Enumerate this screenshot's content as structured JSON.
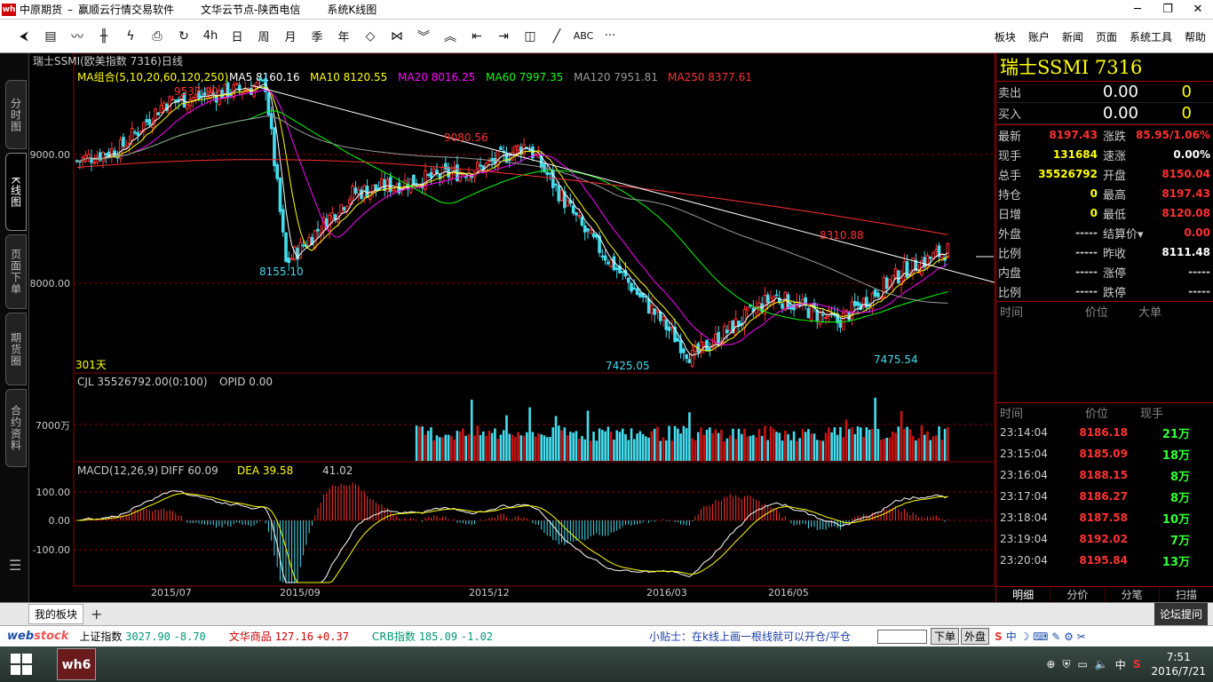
{
  "window": {
    "logo": "wh",
    "title": "中原期货",
    "dash": "–",
    "software": "赢顺云行情交易软件",
    "node": "文华云节点-陕西电信",
    "linetype": "系统K线图",
    "min": "─",
    "restore": "❐",
    "close": "✕"
  },
  "toolbar": {
    "icons": [
      "back-icon",
      "quote-list-icon",
      "line-chart-icon",
      "kline-icon",
      "flash-icon",
      "save-icon",
      "refresh-icon"
    ],
    "periods": [
      "4h",
      "日",
      "周",
      "月",
      "季",
      "年"
    ],
    "tools_icons": [
      "diamond-icon",
      "bowtie-icon",
      "chevron-down-double-icon",
      "chevron-up-double-icon",
      "arrow-left-icon",
      "arrow-right-icon",
      "grid-icon",
      "draw-line-icon"
    ],
    "abc": "ABC",
    "more": "···",
    "menus": [
      "板块",
      "账户",
      "新闻",
      "页面",
      "系统工具",
      "帮助"
    ]
  },
  "left_tabs": [
    "分时图",
    "K线图",
    "页面下单",
    "期货圈",
    "合约资料"
  ],
  "left_menu_icon": "☰",
  "chart": {
    "header": "瑞士SSMI(欧美指数 7316)日线",
    "ma_label": "MA组合(5,10,20,60,120,250)",
    "ma": [
      {
        "name": "MA5 8160.16",
        "color": "#ffffff"
      },
      {
        "name": "MA10 8120.55",
        "color": "#ffff00"
      },
      {
        "name": "MA20 8016.25",
        "color": "#ff00ff"
      },
      {
        "name": "MA60 7997.35",
        "color": "#00ff00"
      },
      {
        "name": "MA120 7951.81",
        "color": "#9a9a9a"
      },
      {
        "name": "MA250 8377.61",
        "color": "#ff3030"
      }
    ],
    "price_axis": [
      "9000.00",
      "8000.00"
    ],
    "annotations": [
      "9537.90",
      "8155.10",
      "9080.56",
      "7425.05",
      "8310.88",
      "7475.54"
    ],
    "days": "301天",
    "volume_label": "CJL 35526792.00(0:100)",
    "opid_label": "OPID 0.00",
    "volume_axis": "7000万",
    "macd_label": "MACD(12,26,9)",
    "diff_label": "DIFF 60.09",
    "dea_label": "DEA 39.58",
    "macd_value": "41.02",
    "macd_axis": [
      "100.00",
      "0.00",
      "-100.00"
    ],
    "date_axis": [
      "2015/07",
      "2015/09",
      "2015/12",
      "2016/03",
      "2016/05"
    ]
  },
  "quote": {
    "title": "瑞士SSMI  7316",
    "sell_label": "卖出",
    "sell_price": "0.00",
    "sell_vol": "0",
    "buy_label": "买入",
    "buy_price": "0.00",
    "buy_vol": "0",
    "fields": [
      {
        "k": "最新",
        "v": "8197.43",
        "c": "#ff3030"
      },
      {
        "k": "涨跌",
        "v": "85.95/1.06%",
        "c": "#ff3030"
      },
      {
        "k": "现手",
        "v": "131684",
        "c": "#ffff00"
      },
      {
        "k": "速涨",
        "v": "0.00%",
        "c": "#ffffff"
      },
      {
        "k": "总手",
        "v": "35526792",
        "c": "#ffff00"
      },
      {
        "k": "开盘",
        "v": "8150.04",
        "c": "#ff3030"
      },
      {
        "k": "持仓",
        "v": "0",
        "c": "#ffff00"
      },
      {
        "k": "最高",
        "v": "8197.43",
        "c": "#ff3030"
      },
      {
        "k": "日增",
        "v": "0",
        "c": "#ffff00"
      },
      {
        "k": "最低",
        "v": "8120.08",
        "c": "#ff3030"
      },
      {
        "k": "外盘",
        "v": "-----",
        "c": "#cccccc"
      },
      {
        "k": "结算价▾",
        "v": "0.00",
        "c": "#ff3030"
      },
      {
        "k": "比例",
        "v": "-----",
        "c": "#cccccc"
      },
      {
        "k": "昨收",
        "v": "8111.48",
        "c": "#ffffff"
      },
      {
        "k": "内盘",
        "v": "-----",
        "c": "#cccccc"
      },
      {
        "k": "涨停",
        "v": "-----",
        "c": "#cccccc"
      },
      {
        "k": "比例",
        "v": "-----",
        "c": "#cccccc"
      },
      {
        "k": "跌停",
        "v": "-----",
        "c": "#cccccc"
      }
    ],
    "bigorder_header": [
      "时间",
      "价位",
      "大单"
    ],
    "tick_header": [
      "时间",
      "价位",
      "现手"
    ],
    "ticks": [
      {
        "t": "23:14:04",
        "p": "8186.18",
        "v": "21万"
      },
      {
        "t": "23:15:04",
        "p": "8185.09",
        "v": "18万"
      },
      {
        "t": "23:16:04",
        "p": "8188.15",
        "v": "8万"
      },
      {
        "t": "23:17:04",
        "p": "8186.27",
        "v": "8万"
      },
      {
        "t": "23:18:04",
        "p": "8187.58",
        "v": "10万"
      },
      {
        "t": "23:19:04",
        "p": "8192.02",
        "v": "7万"
      },
      {
        "t": "23:20:04",
        "p": "8195.84",
        "v": "13万"
      }
    ],
    "bottom_tabs": [
      "明细",
      "分价",
      "分笔",
      "扫描"
    ]
  },
  "boardbar": {
    "tab": "我的板块",
    "plus": "+",
    "forum": "论坛提问"
  },
  "status": {
    "brand_a": "web",
    "brand_b": "stock",
    "indices": [
      {
        "n": "上证指数",
        "v": "3027.90",
        "d": "-8.70",
        "c": "g"
      },
      {
        "n": "文华商品",
        "v": "127.16",
        "d": "+0.37",
        "c": "r"
      },
      {
        "n": "CRB指数",
        "v": "185.09",
        "d": "-1.02",
        "c": "g"
      }
    ],
    "tip": "小贴士：在k线上画一根线就可以开仓/平仓",
    "btn_buy": "下单",
    "btn_plate": "外盘"
  },
  "taskbar": {
    "app": "wh6",
    "ime": "中",
    "time": "7:51",
    "date": "2016/7/21"
  },
  "chart_data": {
    "type": "candlestick",
    "title": "瑞士SSMI(欧美指数 7316)日线",
    "x_range": [
      "2015/06",
      "2016/07/21"
    ],
    "y_range": [
      7300,
      9700
    ],
    "key_points": [
      {
        "date": "2015/06",
        "value": 8950
      },
      {
        "date": "2015/07",
        "value": 9400
      },
      {
        "date": "2015/08",
        "value": 9537.9
      },
      {
        "date": "2015/08",
        "value": 8155.1
      },
      {
        "date": "2015/09",
        "value": 8700
      },
      {
        "date": "2015/11",
        "value": 8900
      },
      {
        "date": "2015/12",
        "value": 9080.56
      },
      {
        "date": "2016/01",
        "value": 8400
      },
      {
        "date": "2016/02",
        "value": 7425.05
      },
      {
        "date": "2016/03",
        "value": 7900
      },
      {
        "date": "2016/04",
        "value": 7700
      },
      {
        "date": "2016/05",
        "value": 8100
      },
      {
        "date": "2016/06",
        "value": 8310.88
      },
      {
        "date": "2016/06",
        "value": 7475.54
      },
      {
        "date": "2016/07/21",
        "value": 8197.43
      }
    ],
    "ma250_range": [
      8900,
      8377.61
    ]
  }
}
